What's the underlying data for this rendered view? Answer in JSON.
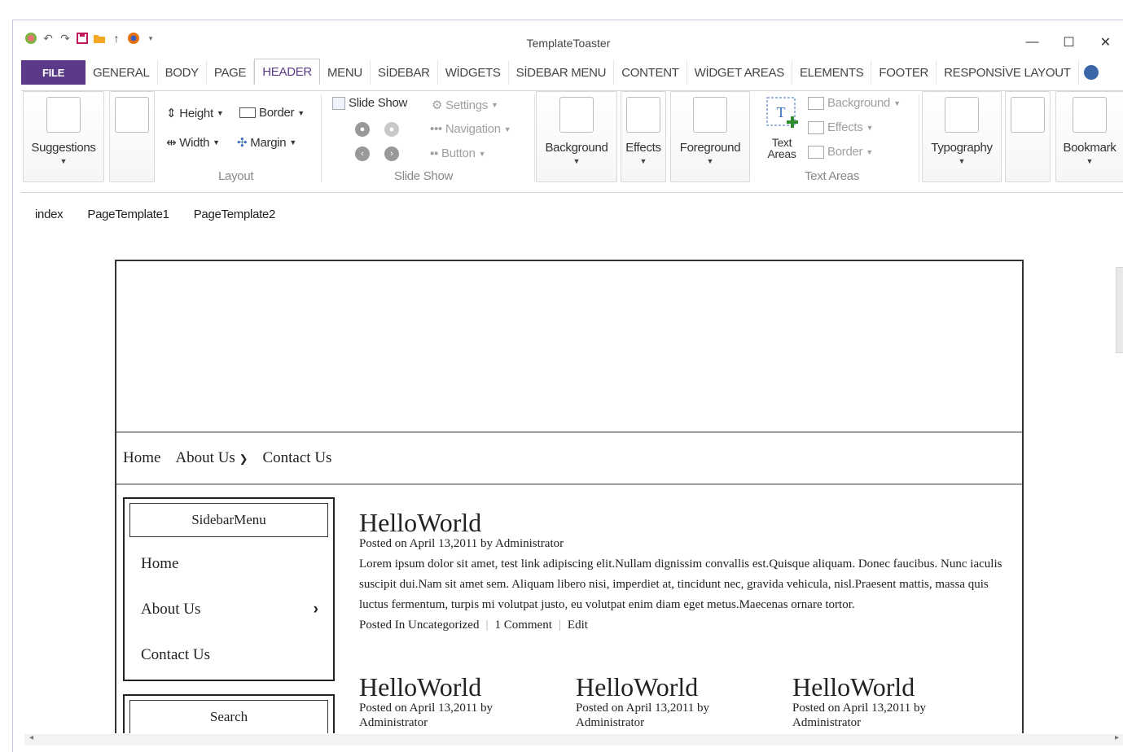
{
  "app": {
    "title": "TemplateToaster"
  },
  "window_controls": {
    "minimize": "—",
    "maximize": "☐",
    "close": "✕"
  },
  "quick_access": [
    "app-logo-icon",
    "undo-icon",
    "redo-icon",
    "save-icon",
    "open-folder-icon",
    "upload-icon",
    "browser-preview-icon",
    "dropdown-arrow-icon"
  ],
  "tabs": [
    "FILE",
    "GENERAL",
    "BODY",
    "PAGE",
    "HEADER",
    "MENU",
    "SİDEBAR",
    "WİDGETS",
    "SİDEBAR MENU",
    "CONTENT",
    "WİDGET AREAS",
    "ELEMENTS",
    "FOOTER",
    "RESPONSİVE LAYOUT"
  ],
  "active_tab": "HEADER",
  "ribbon": {
    "suggestions": "Suggestions",
    "layout": {
      "height": "Height",
      "border": "Border",
      "width": "Width",
      "margin": "Margin",
      "label": "Layout"
    },
    "slideshow": {
      "toggle": "Slide Show",
      "settings": "Settings",
      "navigation": "Navigation",
      "button": "Button",
      "label": "Slide Show"
    },
    "background": "Background",
    "effects": "Effects",
    "foreground": "Foreground",
    "text_areas": {
      "big": "Text Areas",
      "background": "Background",
      "effects": "Effects",
      "border": "Border",
      "label": "Text Areas"
    },
    "typography": "Typography",
    "bookmark": "Bookmark"
  },
  "page_tabs": [
    "index",
    "PageTemplate1",
    "PageTemplate2"
  ],
  "preview": {
    "nav": {
      "home": "Home",
      "about": "About Us",
      "contact": "Contact Us"
    },
    "sidebar_menu": {
      "title": "SidebarMenu",
      "items": [
        "Home",
        "About Us",
        "Contact Us"
      ]
    },
    "search": {
      "title": "Search"
    },
    "main_post": {
      "title": "HelloWorld",
      "meta": "Posted on April 13,2011 by Administrator",
      "body": "Lorem ipsum dolor sit amet, test link adipiscing elit.Nullam dignissim convallis est.Quisque aliquam. Donec faucibus. Nunc iaculis suscipit dui.Nam sit amet sem. Aliquam libero nisi, imperdiet at, tincidunt nec, gravida vehicula, nisl.Praesent mattis, massa quis luctus fermentum, turpis mi volutpat justo, eu volutpat enim diam eget metus.Maecenas ornare tortor.",
      "category": "Posted In Uncategorized",
      "comments": "1 Comment",
      "edit": "Edit"
    },
    "small_posts": [
      {
        "title": "HelloWorld",
        "meta": "Posted on April 13,2011 by",
        "author": "Administrator"
      },
      {
        "title": "HelloWorld",
        "meta": "Posted on April 13,2011 by",
        "author": "Administrator"
      },
      {
        "title": "HelloWorld",
        "meta": "Posted on April 13,2011 by",
        "author": "Administrator"
      }
    ]
  },
  "colors": {
    "file_tab": "#5b3b87",
    "active_tab_text": "#5b3b87",
    "text_area_accent": "#2e8b2e"
  }
}
